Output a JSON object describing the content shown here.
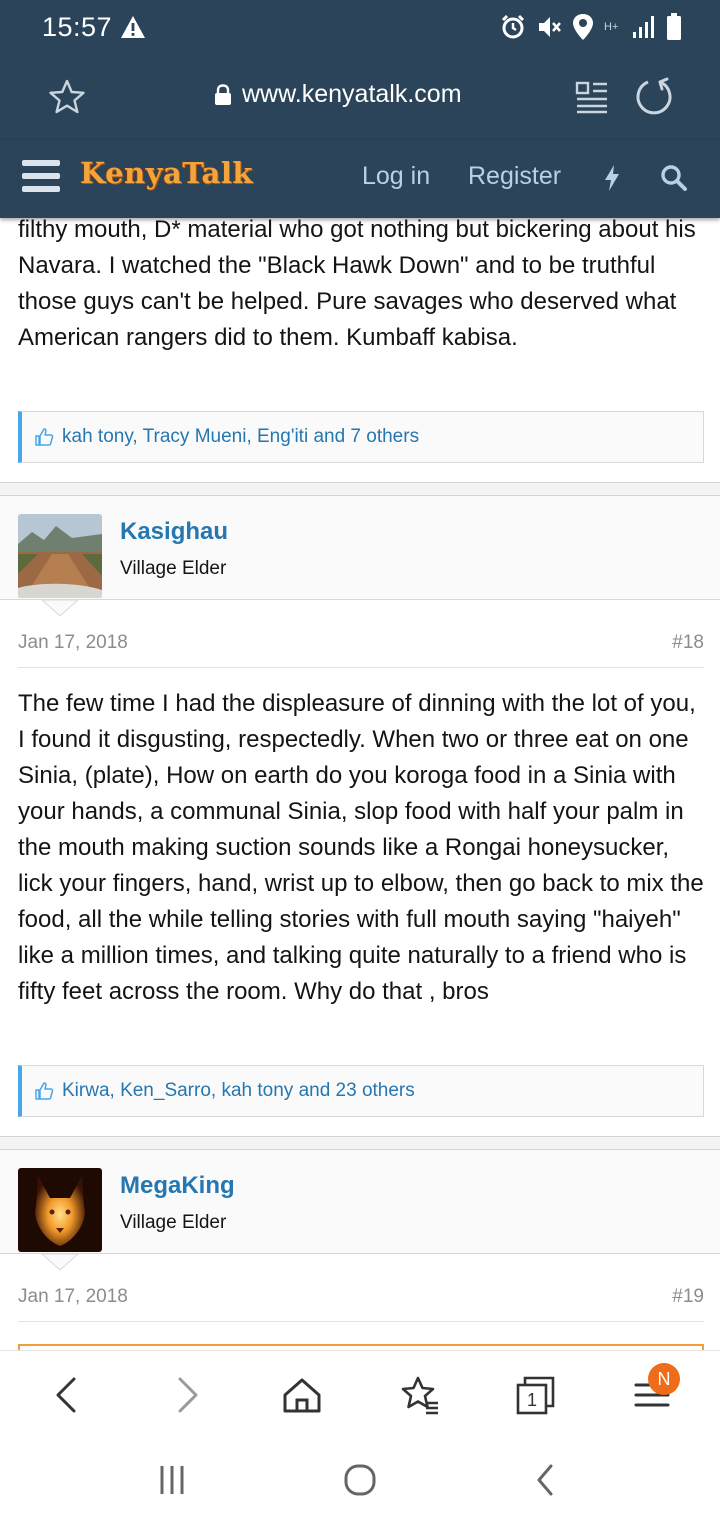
{
  "status_bar": {
    "time": "15:57",
    "network": "H+",
    "icons": [
      "warning-icon",
      "alarm-icon",
      "mute-icon",
      "location-icon",
      "signal-icon",
      "battery-icon"
    ]
  },
  "browser": {
    "url": "www.kenyatalk.com",
    "icons": [
      "star-icon",
      "lock-icon",
      "reader-mode-icon",
      "reload-icon"
    ]
  },
  "site_header": {
    "logo": "KenyaTalk",
    "login": "Log in",
    "register": "Register",
    "icons": [
      "menu-icon",
      "bolt-icon",
      "search-icon"
    ]
  },
  "posts": [
    {
      "body": "filthy mouth, D* material who got nothing but bickering about his Navara. I watched the \"Black Hawk Down\" and to be truthful those guys can't be helped. Pure savages who deserved what American rangers did to them. Kumbaff kabisa.",
      "reactions": "kah tony, Tracy Mueni, Eng'iti and 7 others"
    },
    {
      "author": "Kasighau",
      "user_title": "Village Elder",
      "date": "Jan 17, 2018",
      "number": "#18",
      "body": "The few time I had the displeasure of dinning with the lot of you, I found it disgusting, respectedly. When two or three eat on one Sinia, (plate), How on earth do you koroga food in a Sinia with your hands, a communal Sinia, slop food with half your palm in the mouth making suction sounds like a Rongai honeysucker, lick your fingers, hand, wrist up to elbow, then go back to mix the food, all the while telling stories with full mouth saying \"haiyeh\" like a million times, and talking quite naturally to a friend who is fifty feet across the room. Why do that , bros",
      "reactions": "Kirwa, Ken_Sarro, kah tony and 23 others"
    },
    {
      "author": "MegaKing",
      "user_title": "Village Elder",
      "date": "Jan 17, 2018",
      "number": "#19"
    }
  ],
  "bottom_bar": {
    "icons": [
      "back-icon",
      "forward-icon",
      "home-icon",
      "bookmarks-icon",
      "tabs-icon",
      "menu-icon"
    ],
    "tab_count": "1",
    "badge": "N"
  },
  "system_nav": {
    "icons": [
      "recents-icon",
      "home-circle-icon",
      "back-chevron-icon"
    ]
  },
  "colors": {
    "header_bg": "#2b4459",
    "link": "#2577b1",
    "logo": "#f4a43c",
    "reaction_bar": "#47a7eb",
    "badge": "#ef6c1a"
  }
}
